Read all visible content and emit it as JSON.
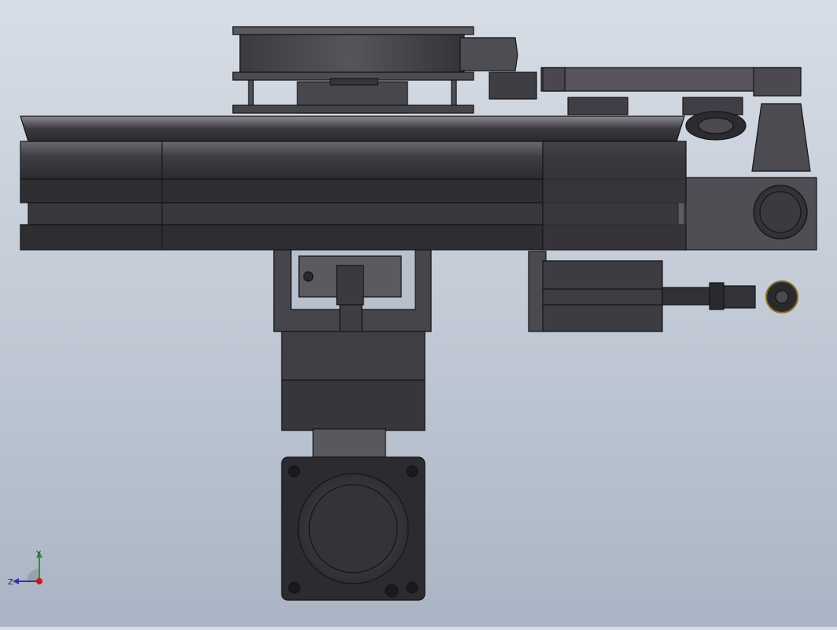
{
  "view": {
    "background_top": "#d7dde6",
    "background_bottom": "#aab4c4",
    "part_fill_dark": "#3c3c42",
    "part_fill_mid": "#4a4a50",
    "part_fill_light": "#5a5a60",
    "edge_color": "#1a1a1a"
  },
  "triad": {
    "y_label": "Y",
    "z_label": "Z",
    "y_axis_color": "#1aa01a",
    "z_axis_color": "#2a3aa8",
    "origin_color": "#d01818"
  }
}
